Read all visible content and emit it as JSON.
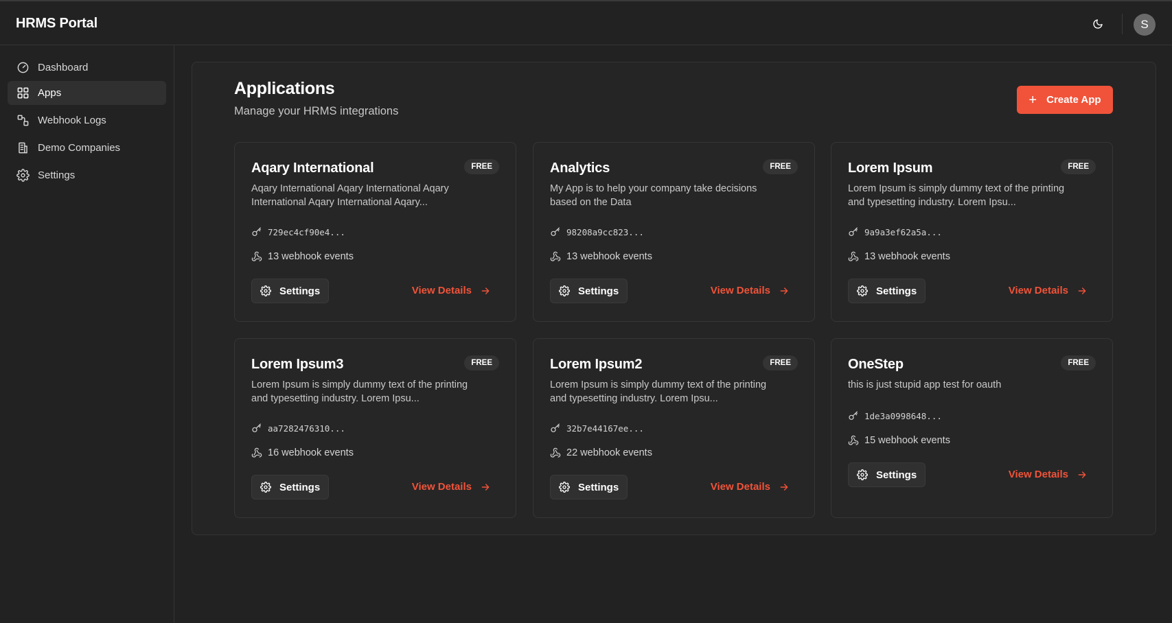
{
  "header": {
    "brand": "HRMS Portal",
    "theme_icon": "moon-icon",
    "avatar_initial": "S"
  },
  "sidebar": {
    "items": [
      {
        "label": "Dashboard",
        "icon": "gauge-icon",
        "active": false
      },
      {
        "label": "Apps",
        "icon": "grid-icon",
        "active": true
      },
      {
        "label": "Webhook Logs",
        "icon": "webhook-logs-icon",
        "active": false
      },
      {
        "label": "Demo Companies",
        "icon": "building-icon",
        "active": false
      },
      {
        "label": "Settings",
        "icon": "gear-icon",
        "active": false
      }
    ]
  },
  "main": {
    "title": "Applications",
    "subtitle": "Manage your HRMS integrations",
    "create_label": "Create App",
    "settings_label": "Settings",
    "view_details_label": "View Details",
    "apps": [
      {
        "name": "Aqary International",
        "badge": "FREE",
        "description": "Aqary International Aqary International Aqary International Aqary International Aqary...",
        "key": "729ec4cf90e4...",
        "events": "13 webhook events"
      },
      {
        "name": "Analytics",
        "badge": "FREE",
        "description": "My App is to help your company take decisions based on the Data",
        "key": "98208a9cc823...",
        "events": "13 webhook events"
      },
      {
        "name": "Lorem Ipsum",
        "badge": "FREE",
        "description": "Lorem Ipsum is simply dummy text of the printing and typesetting industry. Lorem Ipsu...",
        "key": "9a9a3ef62a5a...",
        "events": "13 webhook events"
      },
      {
        "name": "Lorem Ipsum3",
        "badge": "FREE",
        "description": "Lorem Ipsum is simply dummy text of the printing and typesetting industry. Lorem Ipsu...",
        "key": "aa7282476310...",
        "events": "16 webhook events"
      },
      {
        "name": "Lorem Ipsum2",
        "badge": "FREE",
        "description": "Lorem Ipsum is simply dummy text of the printing and typesetting industry. Lorem Ipsu...",
        "key": "32b7e44167ee...",
        "events": "22 webhook events"
      },
      {
        "name": "OneStep",
        "badge": "FREE",
        "description": "this is just stupid app test for oauth",
        "key": "1de3a0998648...",
        "events": "15 webhook events"
      }
    ]
  },
  "colors": {
    "background": "#222222",
    "accent": "#f0533a",
    "card": "#262626"
  }
}
